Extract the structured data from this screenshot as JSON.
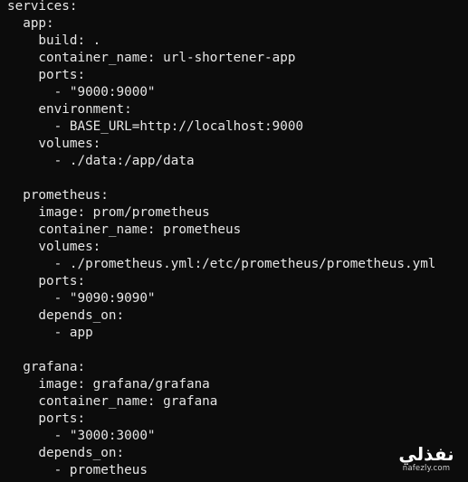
{
  "lines": [
    "services:",
    "  app:",
    "    build: .",
    "    container_name: url-shortener-app",
    "    ports:",
    "      - \"9000:9000\"",
    "    environment:",
    "      - BASE_URL=http://localhost:9000",
    "    volumes:",
    "      - ./data:/app/data",
    "",
    "  prometheus:",
    "    image: prom/prometheus",
    "    container_name: prometheus",
    "    volumes:",
    "      - ./prometheus.yml:/etc/prometheus/prometheus.yml",
    "    ports:",
    "      - \"9090:9090\"",
    "    depends_on:",
    "      - app",
    "",
    "  grafana:",
    "    image: grafana/grafana",
    "    container_name: grafana",
    "    ports:",
    "      - \"3000:3000\"",
    "    depends_on:",
    "      - prometheus"
  ],
  "watermark": {
    "logo_text": "نفذلي",
    "url": "nafezly.com"
  },
  "colors": {
    "background": "#0c0c0c",
    "text": "#e6e6e6"
  }
}
